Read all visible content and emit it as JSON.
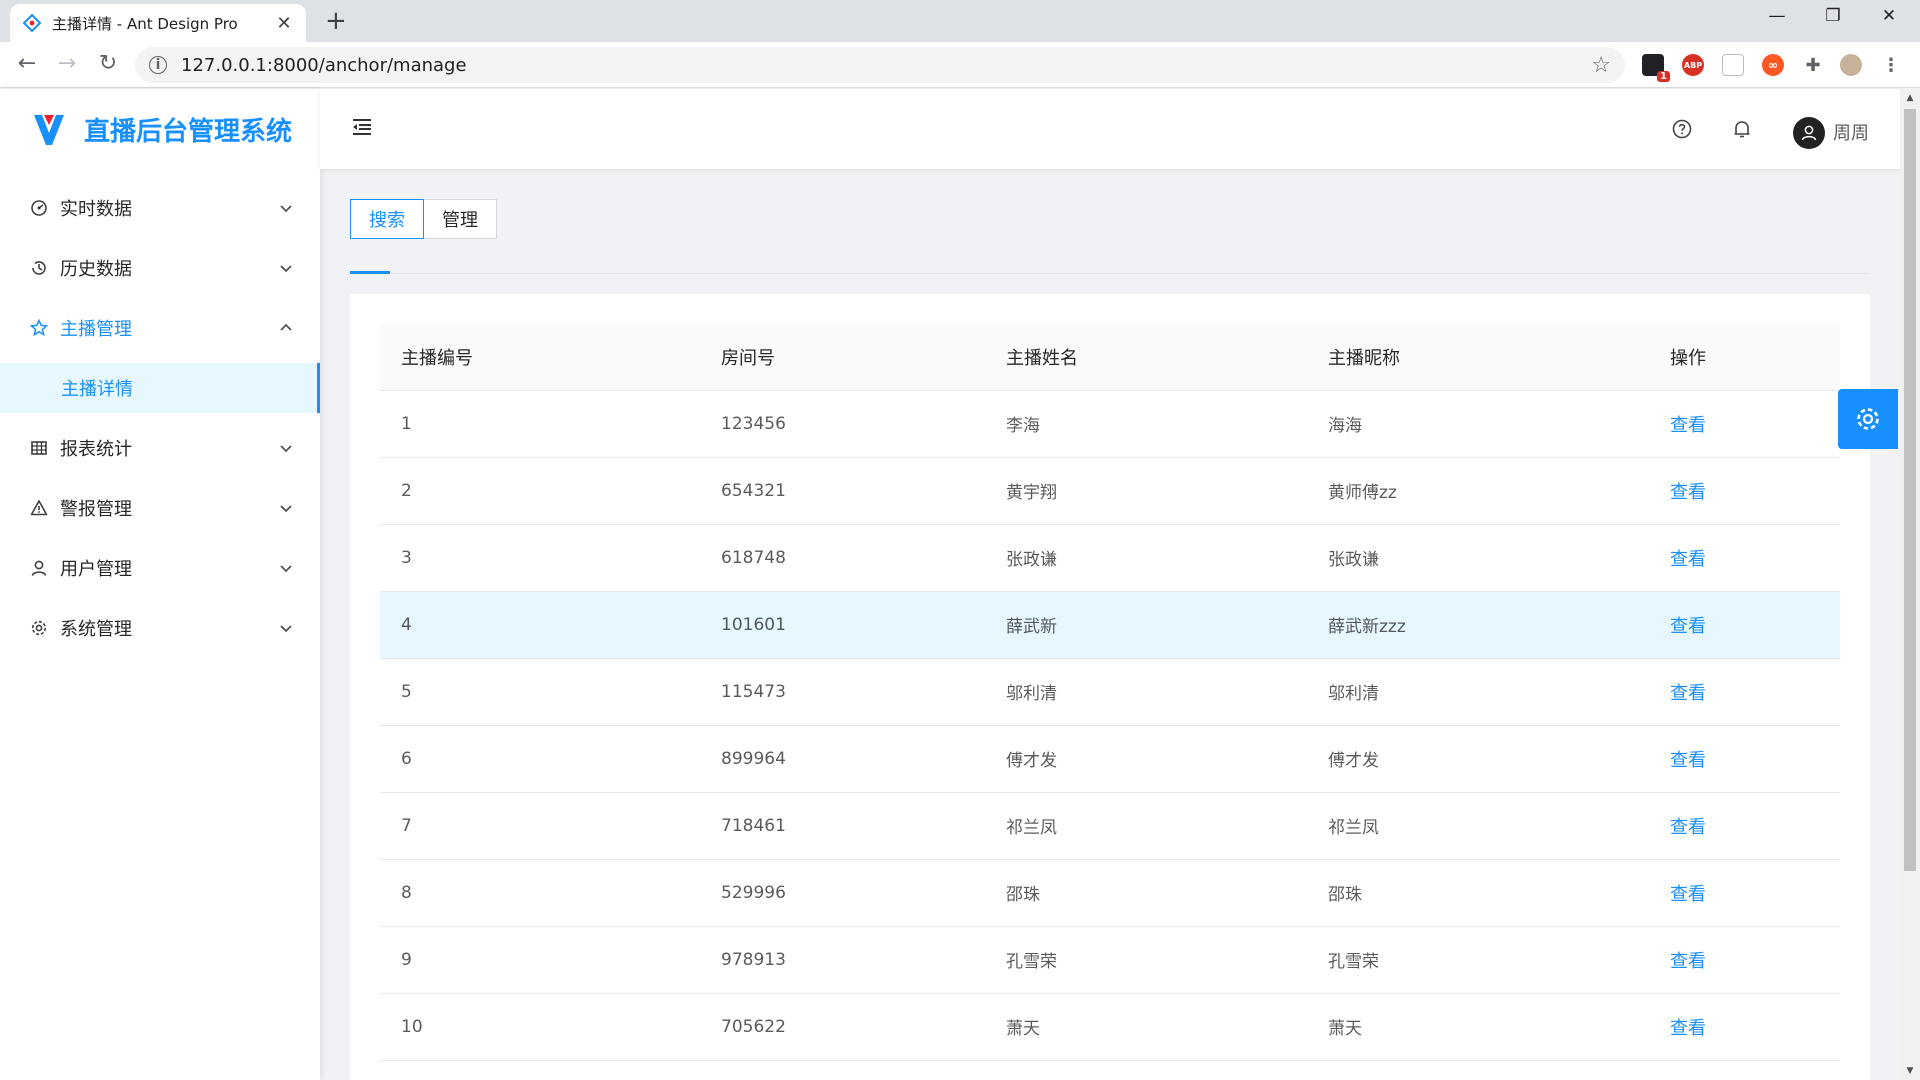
{
  "browser": {
    "tab_title": "主播详情 - Ant Design Pro",
    "url": "127.0.0.1:8000/anchor/manage",
    "extension_badge": "1",
    "abp_label": "ABP"
  },
  "app": {
    "title": "直播后台管理系统",
    "brand_color": "#1890ff"
  },
  "sidebar": {
    "items": [
      {
        "label": "实时数据",
        "icon": "dashboard-icon",
        "open": false
      },
      {
        "label": "历史数据",
        "icon": "history-icon",
        "open": false
      },
      {
        "label": "主播管理",
        "icon": "star-icon",
        "open": true
      },
      {
        "label": "主播详情",
        "sub": true,
        "selected": true
      },
      {
        "label": "报表统计",
        "icon": "table-icon",
        "open": false
      },
      {
        "label": "警报管理",
        "icon": "warning-icon",
        "open": false
      },
      {
        "label": "用户管理",
        "icon": "user-icon",
        "open": false
      },
      {
        "label": "系统管理",
        "icon": "setting-icon",
        "open": false
      }
    ]
  },
  "header": {
    "username": "周周"
  },
  "tabs": [
    {
      "label": "搜索",
      "active": true
    },
    {
      "label": "管理",
      "active": false
    }
  ],
  "table": {
    "columns": [
      "主播编号",
      "房间号",
      "主播姓名",
      "主播昵称",
      "操作"
    ],
    "rows": [
      {
        "id": "1",
        "room": "123456",
        "name": "李海",
        "nickname": "海海",
        "action": "查看"
      },
      {
        "id": "2",
        "room": "654321",
        "name": "黄宇翔",
        "nickname": "黄师傅zz",
        "action": "查看"
      },
      {
        "id": "3",
        "room": "618748",
        "name": "张政谦",
        "nickname": "张政谦",
        "action": "查看"
      },
      {
        "id": "4",
        "room": "101601",
        "name": "薛武新",
        "nickname": "薛武新zzz",
        "action": "查看",
        "highlight": true
      },
      {
        "id": "5",
        "room": "115473",
        "name": "邬利清",
        "nickname": "邬利清",
        "action": "查看"
      },
      {
        "id": "6",
        "room": "899964",
        "name": "傅才发",
        "nickname": "傅才发",
        "action": "查看"
      },
      {
        "id": "7",
        "room": "718461",
        "name": "祁兰凤",
        "nickname": "祁兰凤",
        "action": "查看"
      },
      {
        "id": "8",
        "room": "529996",
        "name": "邵珠",
        "nickname": "邵珠",
        "action": "查看"
      },
      {
        "id": "9",
        "room": "978913",
        "name": "孔雪荣",
        "nickname": "孔雪荣",
        "action": "查看"
      },
      {
        "id": "10",
        "room": "705622",
        "name": "萧天",
        "nickname": "萧天",
        "action": "查看"
      }
    ]
  }
}
